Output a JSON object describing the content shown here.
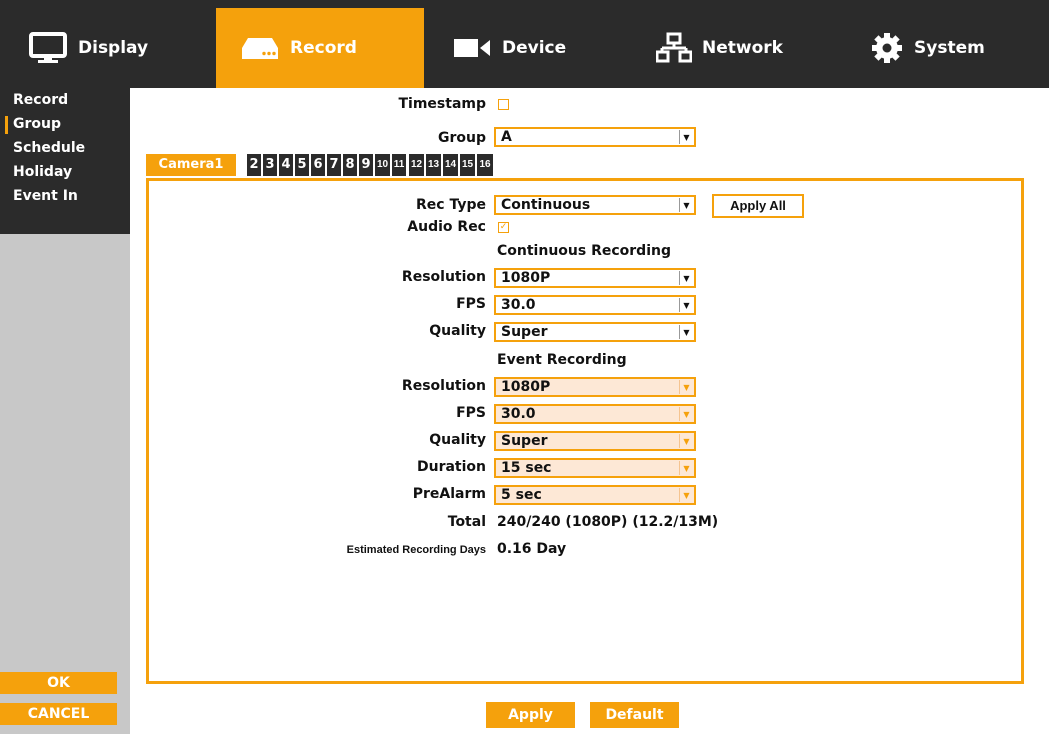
{
  "nav": {
    "tabs": [
      {
        "label": "Display",
        "icon": "monitor-icon"
      },
      {
        "label": "Record",
        "icon": "dvr-icon"
      },
      {
        "label": "Device",
        "icon": "camera-icon"
      },
      {
        "label": "Network",
        "icon": "network-icon"
      },
      {
        "label": "System",
        "icon": "gear-icon"
      }
    ],
    "active": "Record"
  },
  "sidebar": {
    "items": [
      "Record",
      "Group",
      "Schedule",
      "Holiday",
      "Event In"
    ],
    "selected": "Group",
    "ok_label": "OK",
    "cancel_label": "CANCEL"
  },
  "form": {
    "timestamp_label": "Timestamp",
    "timestamp_checked": false,
    "group_label": "Group",
    "group_value": "A"
  },
  "camera_tabs": {
    "active_label": "Camera1",
    "numbers": [
      "2",
      "3",
      "4",
      "5",
      "6",
      "7",
      "8",
      "9",
      "10",
      "11",
      "12",
      "13",
      "14",
      "15",
      "16"
    ]
  },
  "panel": {
    "rec_type_label": "Rec Type",
    "rec_type_value": "Continuous",
    "apply_all_label": "Apply All",
    "audio_rec_label": "Audio Rec",
    "audio_rec_checked": true,
    "continuous": {
      "heading": "Continuous Recording",
      "resolution_label": "Resolution",
      "resolution_value": "1080P",
      "fps_label": "FPS",
      "fps_value": "30.0",
      "quality_label": "Quality",
      "quality_value": "Super"
    },
    "event": {
      "heading": "Event Recording",
      "resolution_label": "Resolution",
      "resolution_value": "1080P",
      "fps_label": "FPS",
      "fps_value": "30.0",
      "quality_label": "Quality",
      "quality_value": "Super",
      "duration_label": "Duration",
      "duration_value": "15 sec",
      "prealarm_label": "PreAlarm",
      "prealarm_value": "5 sec"
    },
    "total_label": "Total",
    "total_value": "240/240 (1080P) (12.2/13M)",
    "est_days_label": "Estimated Recording Days",
    "est_days_value": "0.16 Day"
  },
  "footer": {
    "apply_label": "Apply",
    "default_label": "Default"
  },
  "colors": {
    "accent": "#f5a10c",
    "dark": "#2b2b2b",
    "sidebar_bg": "#c8c8c8",
    "event_field_bg": "#fde8d6"
  }
}
